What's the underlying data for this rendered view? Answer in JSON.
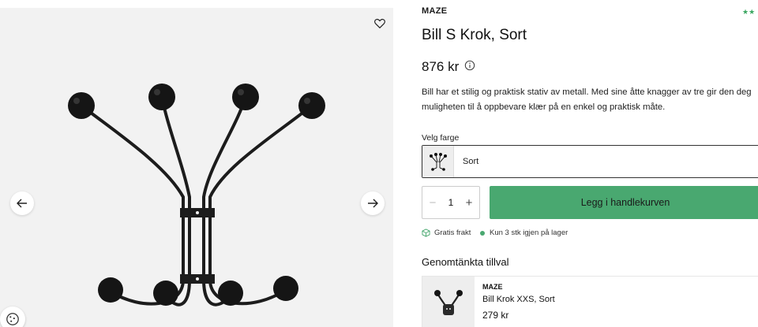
{
  "product": {
    "brand": "MAZE",
    "rating_stars": "★★",
    "title": "Bill S Krok, Sort",
    "price": "876 kr",
    "description_line1": "Bill har et stilig og praktisk stativ av metall. Med sine åtte knagger av tre gir den deg",
    "description_line2": "muligheten til å oppbevare klær på en enkel og praktisk måte."
  },
  "gallery": {
    "icons": {
      "favorite": "heart-icon",
      "prev": "arrow-left-icon",
      "next": "arrow-right-icon",
      "cookie": "cookie-icon"
    }
  },
  "color_picker": {
    "label": "Velg farge",
    "selected": "Sort"
  },
  "purchase": {
    "quantity": "1",
    "minus": "−",
    "plus": "+",
    "add_to_cart": "Legg i handlekurven"
  },
  "usps": {
    "shipping": "Gratis frakt",
    "stock": "Kun 3 stk igjen på lager"
  },
  "addons": {
    "title": "Genomtänkta tillval",
    "items": [
      {
        "brand": "MAZE",
        "name": "Bill Krok XXS, Sort",
        "price": "279 kr"
      }
    ]
  },
  "colors": {
    "accent_green": "#49a870",
    "star_green": "#3aa660",
    "gallery_bg": "#f2f2f2"
  }
}
